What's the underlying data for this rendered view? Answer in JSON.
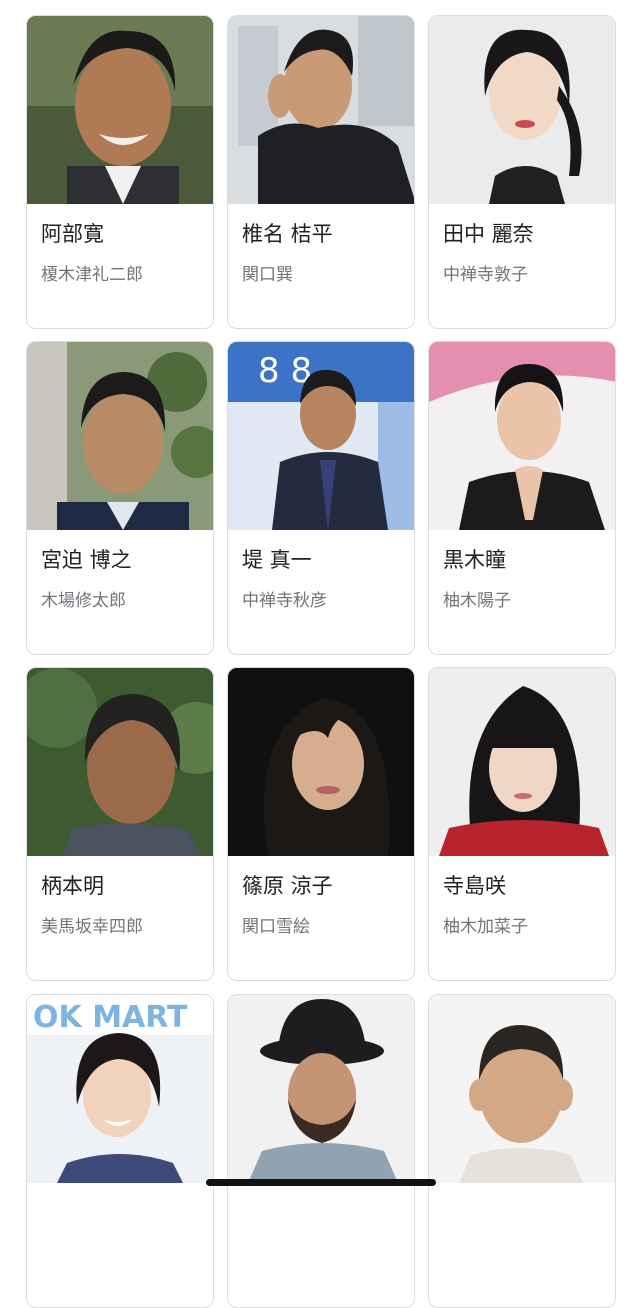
{
  "cast": [
    {
      "name": "阿部寛",
      "role": "榎木津礼二郎",
      "photo": "portrait-man-smiling-outdoor"
    },
    {
      "name": "椎名 桔平",
      "role": "関口巽",
      "photo": "portrait-man-city"
    },
    {
      "name": "田中 麗奈",
      "role": "中禅寺敦子",
      "photo": "portrait-woman-white-bg"
    },
    {
      "name": "宮迫 博之",
      "role": "木場修太郎",
      "photo": "portrait-man-suit-green-bg"
    },
    {
      "name": "堤 真一",
      "role": "中禅寺秋彦",
      "photo": "portrait-man-suit-blue-bg"
    },
    {
      "name": "黒木瞳",
      "role": "柚木陽子",
      "photo": "portrait-woman-pink-bg"
    },
    {
      "name": "柄本明",
      "role": "美馬坂幸四郎",
      "photo": "portrait-man-trees"
    },
    {
      "name": "篠原 涼子",
      "role": "関口雪絵",
      "photo": "portrait-woman-dark-bg"
    },
    {
      "name": "寺島咲",
      "role": "柚木加菜子",
      "photo": "portrait-woman-long-hair"
    },
    {
      "name": "",
      "role": "",
      "photo": "portrait-woman-bookstore"
    },
    {
      "name": "",
      "role": "",
      "photo": "portrait-man-hat"
    },
    {
      "name": "",
      "role": "",
      "photo": "portrait-man-shaved-head"
    }
  ],
  "signboard_text": "OK MART",
  "sign_numbers": "8 8"
}
